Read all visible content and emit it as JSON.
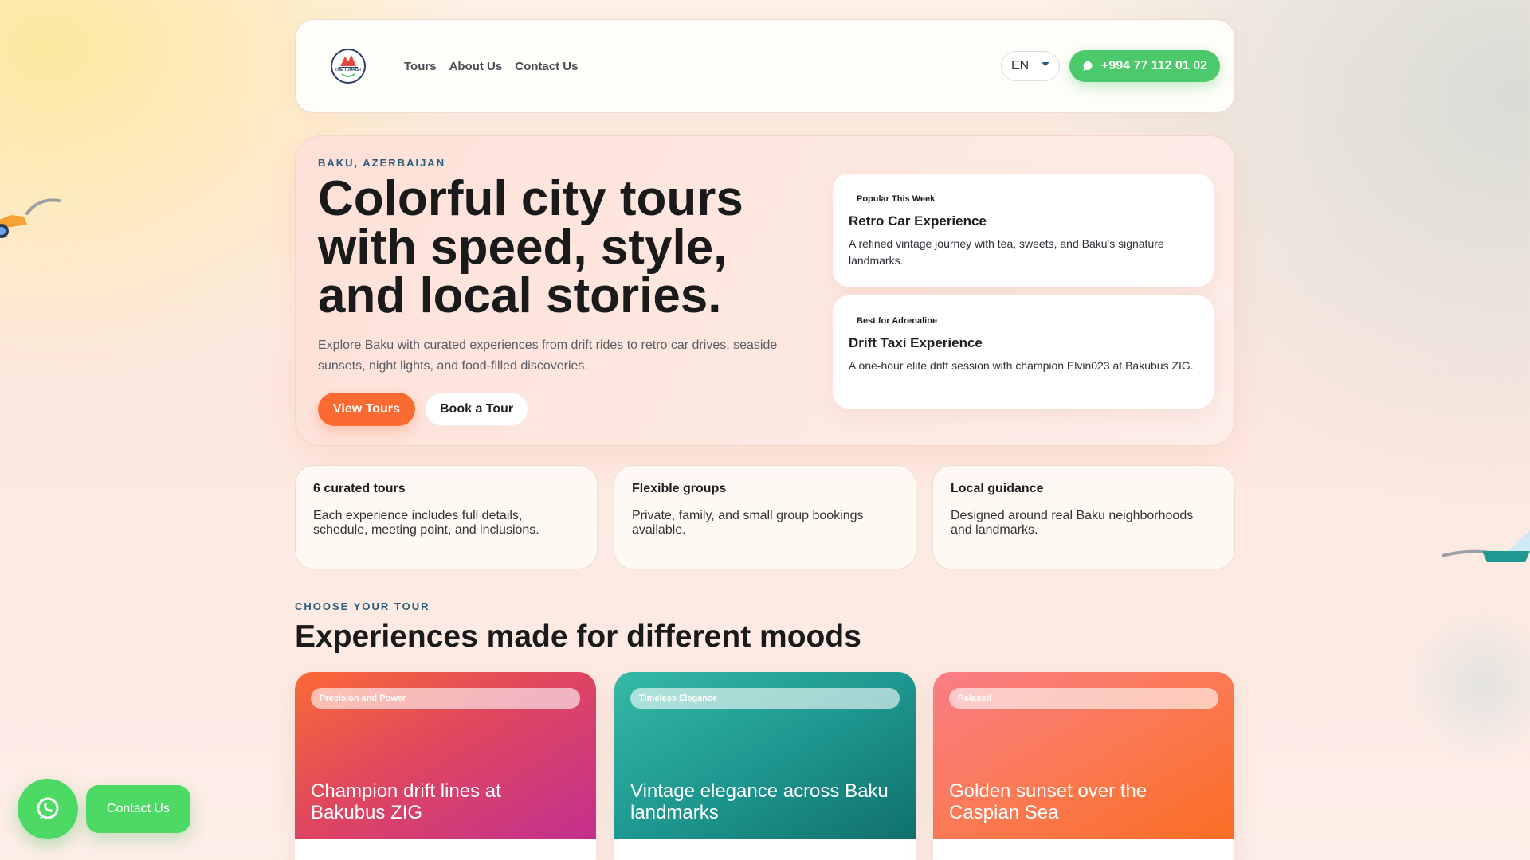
{
  "nav": {
    "logo_text": "THE TOURIST",
    "links": [
      "Tours",
      "About Us",
      "Contact Us"
    ],
    "language": "EN",
    "phone": "+994 77 112 01 02"
  },
  "hero": {
    "eyebrow": "BAKU, AZERBAIJAN",
    "title": "Colorful city tours with speed, style, and local stories.",
    "description": "Explore Baku with curated experiences from drift rides to retro car drives, seaside sunsets, night lights, and food-filled discoveries.",
    "primary_button": "View Tours",
    "secondary_button": "Book a Tour",
    "features": [
      {
        "tag": "Popular This Week",
        "title": "Retro Car Experience",
        "text": "A refined vintage journey with tea, sweets, and Baku's signature landmarks."
      },
      {
        "tag": "Best for Adrenaline",
        "title": "Drift Taxi Experience",
        "text": "A one-hour elite drift session with champion Elvin023 at Bakubus ZIG."
      }
    ]
  },
  "stats": [
    {
      "title": "6 curated tours",
      "text": "Each experience includes full details, schedule, meeting point, and inclusions."
    },
    {
      "title": "Flexible groups",
      "text": "Private, family, and small group bookings available."
    },
    {
      "title": "Local guidance",
      "text": "Designed around real Baku neighborhoods and landmarks."
    }
  ],
  "tours_section": {
    "eyebrow": "CHOOSE YOUR TOUR",
    "title": "Experiences made for different moods",
    "cards": [
      {
        "tag": "Precision and Power",
        "caption": "Champion drift lines at Bakubus ZIG"
      },
      {
        "tag": "Timeless Elegance",
        "caption": "Vintage elegance across Baku landmarks"
      },
      {
        "tag": "Relaxed",
        "caption": "Golden sunset over the Caspian Sea"
      }
    ]
  },
  "floating": {
    "contact_label": "Contact Us"
  },
  "colors": {
    "accent_orange": "#fb6a30",
    "accent_green": "#4cca6b",
    "eyebrow_blue": "#2a5d7c"
  }
}
